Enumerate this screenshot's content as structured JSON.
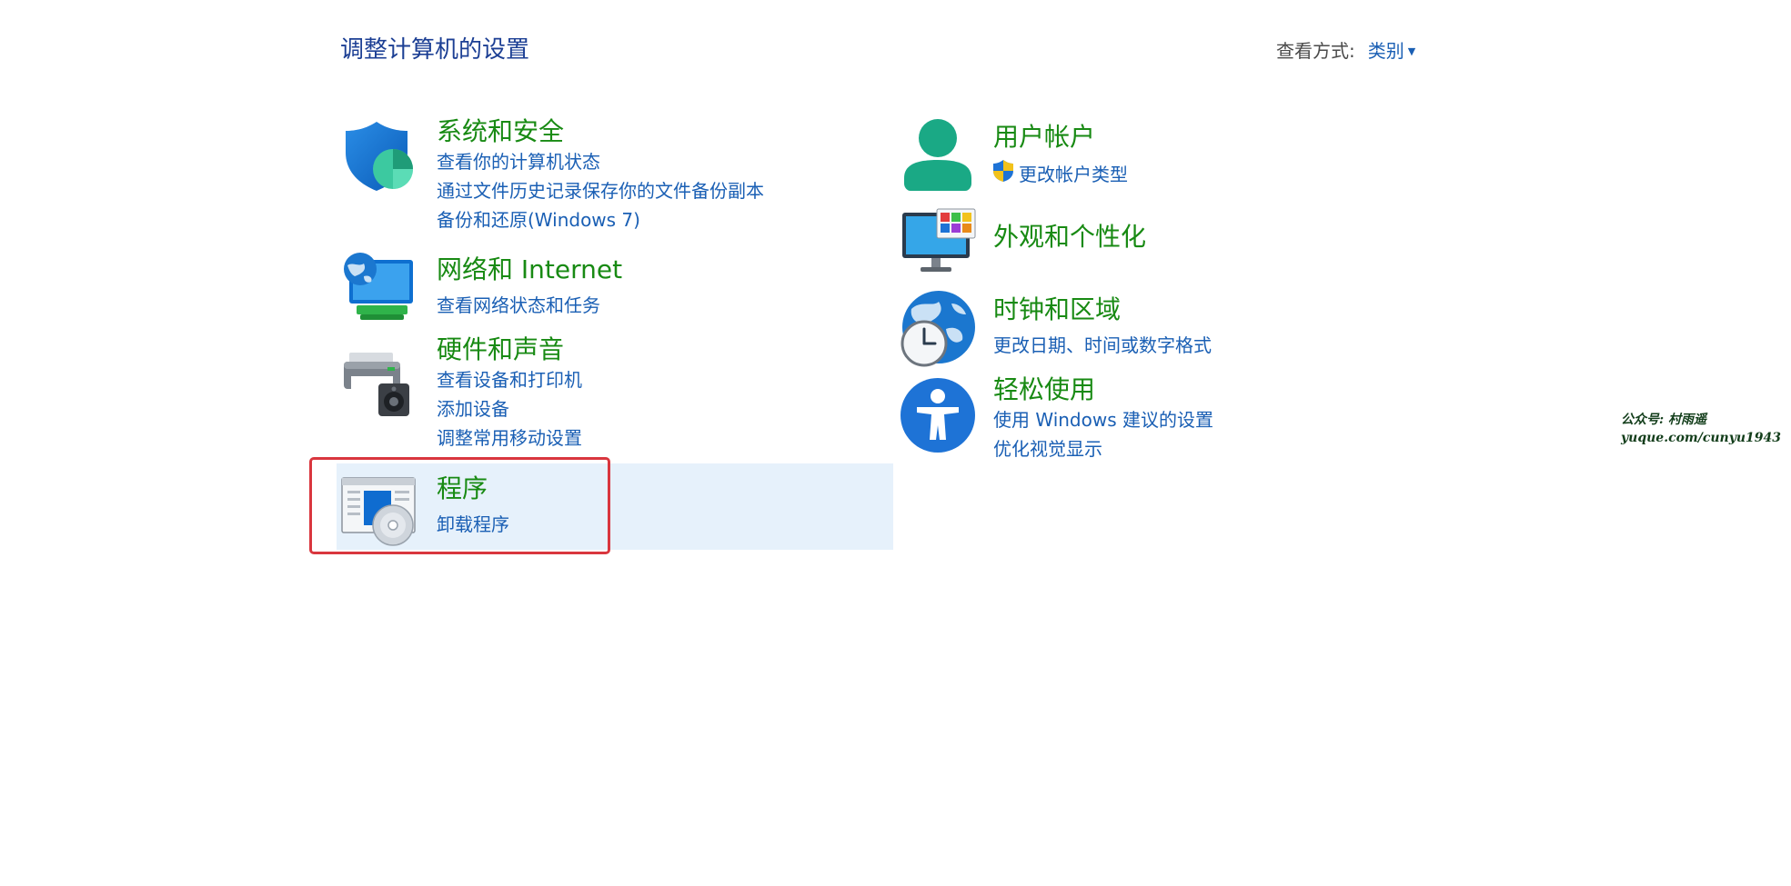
{
  "header": {
    "title": "调整计算机的设置",
    "view_label": "查看方式:",
    "view_value": "类别"
  },
  "categories": {
    "system_security": {
      "title": "系统和安全",
      "links": [
        "查看你的计算机状态",
        "通过文件历史记录保存你的文件备份副本",
        "备份和还原(Windows 7)"
      ]
    },
    "network": {
      "title": "网络和 Internet",
      "links": [
        "查看网络状态和任务"
      ]
    },
    "hardware": {
      "title": "硬件和声音",
      "links": [
        "查看设备和打印机",
        "添加设备",
        "调整常用移动设置"
      ]
    },
    "programs": {
      "title": "程序",
      "links": [
        "卸载程序"
      ]
    },
    "user_accounts": {
      "title": "用户帐户",
      "links": [
        "更改帐户类型"
      ]
    },
    "appearance": {
      "title": "外观和个性化",
      "links": []
    },
    "clock_region": {
      "title": "时钟和区域",
      "links": [
        "更改日期、时间或数字格式"
      ]
    },
    "ease_of_access": {
      "title": "轻松使用",
      "links": [
        "使用 Windows 建议的设置",
        "优化视觉显示"
      ]
    }
  },
  "watermark": {
    "line1": "公众号: 村雨遥",
    "line2": "yuque.com/cunyu1943"
  },
  "colors": {
    "category_title": "#188a13",
    "link": "#1a5fb4",
    "highlight_bg": "#e6f1fb",
    "annotation_border": "#d9363e"
  },
  "icons": {
    "system_security": "shield-icon",
    "network": "network-globe-icon",
    "hardware": "printer-speaker-icon",
    "programs": "program-disc-icon",
    "user_accounts": "user-icon",
    "appearance": "monitor-palette-icon",
    "clock_region": "globe-clock-icon",
    "ease_of_access": "accessibility-icon"
  }
}
